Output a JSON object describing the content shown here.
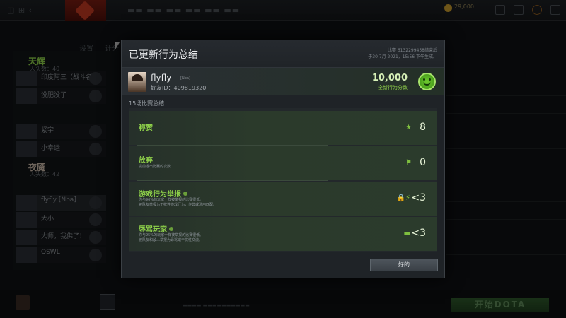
{
  "background": {
    "topbar": {
      "gold": "29,000"
    },
    "subnav": [
      "设置",
      "计分"
    ],
    "radiant": {
      "name": "天辉",
      "sub": "人头数：40"
    },
    "dire": {
      "name": "夜魇",
      "sub": "人头数：42"
    },
    "radiant_players": [
      "印度阿三（战斗名次）",
      "没肥没了",
      "紧宇",
      "小幸运"
    ],
    "dire_players": [
      "flyfly [Nba]",
      "大小",
      "大师，我佛了！",
      "QSWL"
    ],
    "start_button": "开始DOTA"
  },
  "modal": {
    "title": "已更新行为总结",
    "match_line1": "比赛 6132299458结束后",
    "match_line2": "于30 7月 2021，15:56 下午生成。",
    "player": {
      "name": "flyfly",
      "tag": "[Nba]",
      "friend_id_label": "好友ID：",
      "friend_id": "409819320"
    },
    "score": "10,000",
    "score_label": "全新行为分数",
    "summary_label": "15场比赛总结",
    "rows": [
      {
        "label": "称赞",
        "desc": "",
        "value": "8",
        "icon": "star-icon"
      },
      {
        "label": "放弃",
        "desc": "提前退出比赛的次数",
        "value": "0",
        "icon": "flag-icon"
      },
      {
        "label": "游戏行为举报",
        "desc_line1": "你与96%的玩家一样被举报的比赛很低。",
        "desc_line2": "被队友举报为干扰性游戏行为，作弊或滥用匹配。",
        "value": "<3",
        "icon": "lock-bolt-icon"
      },
      {
        "label": "辱骂玩家",
        "desc_line1": "你与95%的玩家一样被举报的比赛很低。",
        "desc_line2": "被队友和敌人举报为辱骂或干扰性交流。",
        "value": "<3",
        "icon": "chat-icon"
      }
    ],
    "ok_button": "好的"
  }
}
